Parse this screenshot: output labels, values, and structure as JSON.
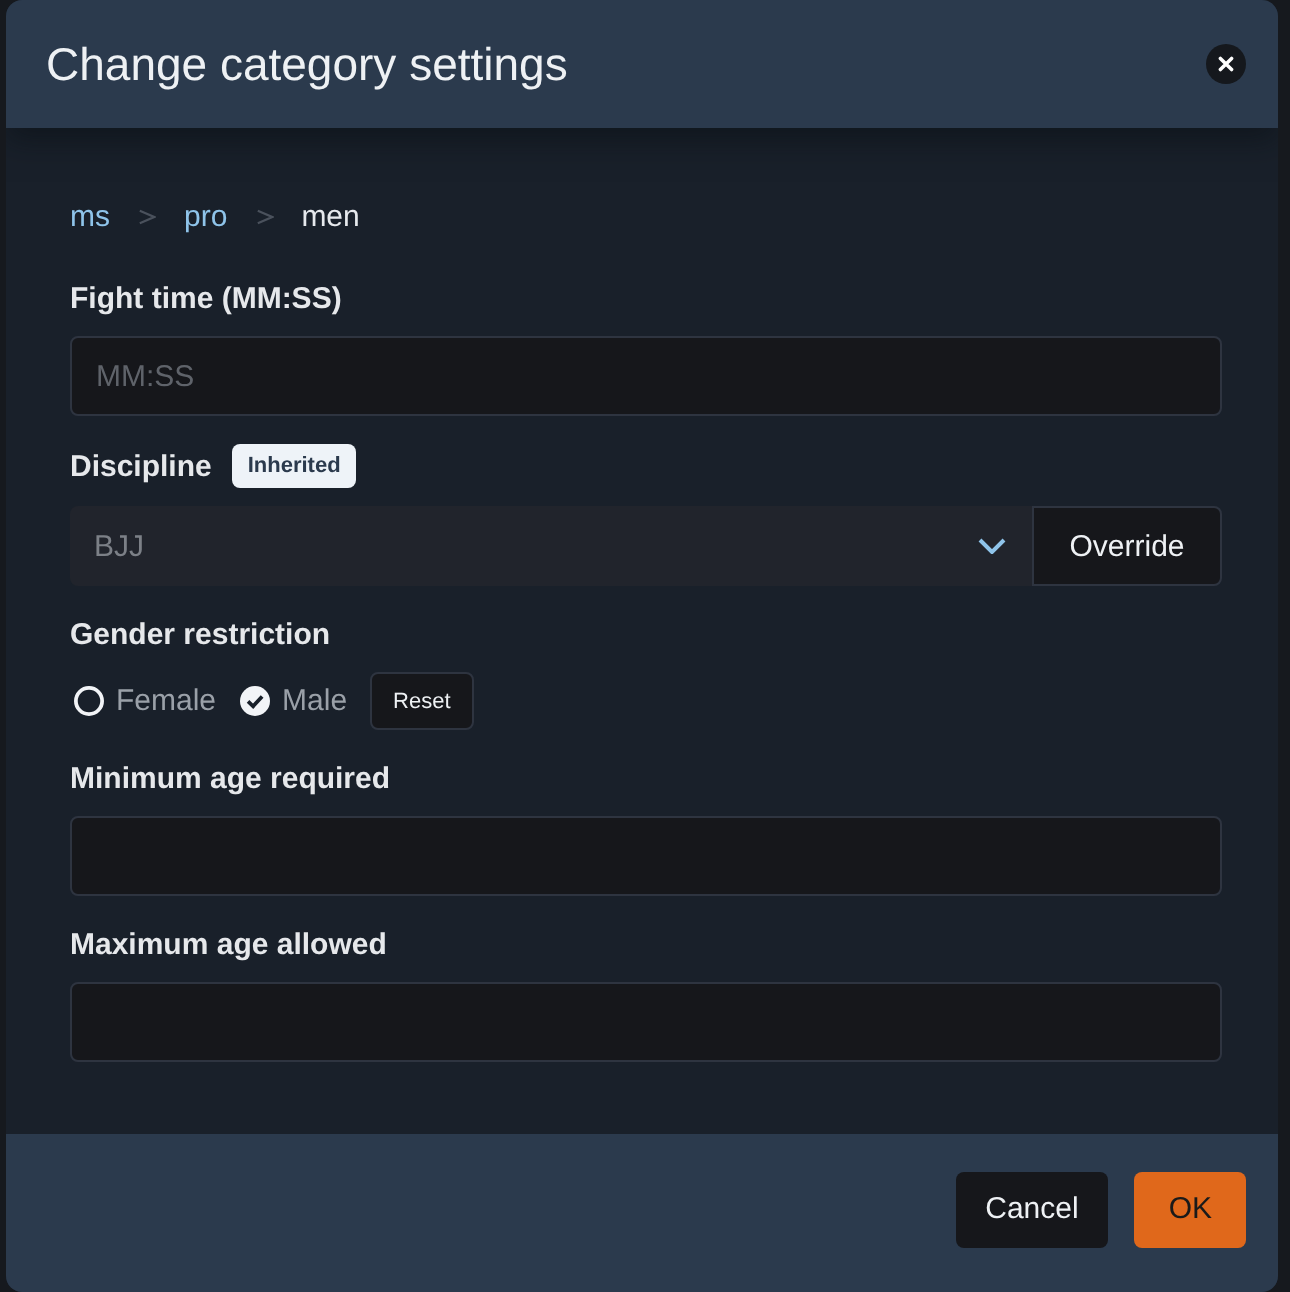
{
  "dialog": {
    "title": "Change category settings"
  },
  "breadcrumb": [
    {
      "label": "ms",
      "current": false
    },
    {
      "label": "pro",
      "current": false
    },
    {
      "label": "men",
      "current": true
    }
  ],
  "fields": [
    {
      "kind": "text",
      "label": "Fight time (MM:SS)",
      "placeholder": "MM:SS"
    },
    {
      "kind": "select",
      "label": "Discipline",
      "badge": "Inherited",
      "value": "BJJ",
      "disabled": true,
      "button": "Override"
    },
    {
      "kind": "radio",
      "label": "Gender restriction",
      "options": [
        {
          "label": "Female",
          "selected": false
        },
        {
          "label": "Male",
          "selected": true
        }
      ],
      "button": "Reset"
    },
    {
      "kind": "text",
      "label": "Minimum age required"
    },
    {
      "kind": "text",
      "label": "Maximum age allowed"
    }
  ],
  "buttons": [
    {
      "label": "Cancel",
      "kind": "secondary"
    },
    {
      "label": "OK",
      "kind": "primary"
    }
  ]
}
